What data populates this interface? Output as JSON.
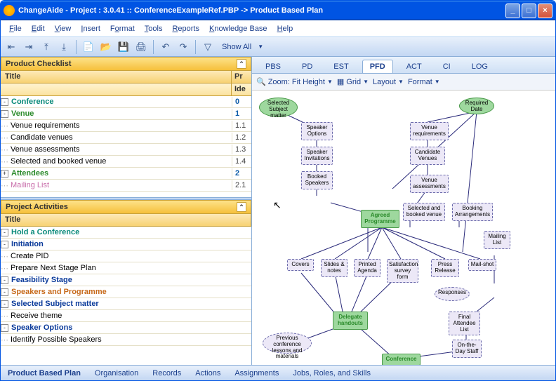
{
  "window": {
    "title": "ChangeAide - Project : 3.0.41  :: ConferenceExampleRef.PBP -> Product Based Plan"
  },
  "menu": {
    "file": "File",
    "edit": "Edit",
    "view": "View",
    "insert": "Insert",
    "format": "Format",
    "tools": "Tools",
    "reports": "Reports",
    "kb": "Knowledge Base",
    "help": "Help"
  },
  "toolbar": {
    "showall": "Show All"
  },
  "checklist": {
    "header": "Product Checklist",
    "col1": "Title",
    "col2": "Pr",
    "col2b": "Ide",
    "items": [
      {
        "label": "Conference",
        "num": "0",
        "lvl": 0,
        "cls": "teal",
        "tog": "-"
      },
      {
        "label": "Venue",
        "num": "1",
        "lvl": 1,
        "cls": "green",
        "tog": "-"
      },
      {
        "label": "Venue requirements",
        "num": "1.1",
        "lvl": 2
      },
      {
        "label": "Candidate venues",
        "num": "1.2",
        "lvl": 2
      },
      {
        "label": "Venue assessments",
        "num": "1.3",
        "lvl": 2
      },
      {
        "label": "Selected and booked venue",
        "num": "1.4",
        "lvl": 2
      },
      {
        "label": "Attendees",
        "num": "2",
        "lvl": 1,
        "cls": "green",
        "tog": "+"
      },
      {
        "label": "Mailing List",
        "num": "2.1",
        "lvl": 2,
        "cls": "pink"
      }
    ]
  },
  "activities": {
    "header": "Project Activities",
    "col1": "Title",
    "items": [
      {
        "label": "Hold a Conference",
        "lvl": 0,
        "cls": "teal",
        "tog": "-"
      },
      {
        "label": "Initiation",
        "lvl": 1,
        "cls": "blue",
        "tog": "-"
      },
      {
        "label": "Create PID",
        "lvl": 2
      },
      {
        "label": "Prepare Next Stage Plan",
        "lvl": 2
      },
      {
        "label": "Feasibility Stage",
        "lvl": 1,
        "cls": "blue",
        "tog": "-"
      },
      {
        "label": "Speakers and Programme",
        "lvl": 2,
        "cls": "orange",
        "tog": "-"
      },
      {
        "label": "Selected Subject matter",
        "lvl": 3,
        "cls": "blue",
        "tog": "-"
      },
      {
        "label": "Receive theme",
        "lvl": 4
      },
      {
        "label": "Speaker Options",
        "lvl": 3,
        "cls": "blue",
        "tog": "-"
      },
      {
        "label": "Identify Possible Speakers",
        "lvl": 4
      }
    ]
  },
  "tabs": {
    "pbs": "PBS",
    "pd": "PD",
    "est": "EST",
    "pfd": "PFD",
    "act": "ACT",
    "ci": "CI",
    "log": "LOG"
  },
  "dtool": {
    "zoom": "Zoom:",
    "fit": "Fit Height",
    "grid": "Grid",
    "layout": "Layout",
    "format": "Format"
  },
  "nodes": {
    "subjmatter": "Selected Subject matter",
    "reqdate": "Required Date",
    "spopt": "Speaker Options",
    "venreq": "Venue requirements",
    "spinv": "Speaker Invitations",
    "candven": "Candidate Venues",
    "bookedsp": "Booked Speakers",
    "venass": "Venue assessments",
    "agprog": "Agreed Programme",
    "selven": "Selected and booked venue",
    "bookarr": "Booking Arrangements",
    "maillist": "Mailing List",
    "covers": "Covers",
    "slides": "Slides & notes",
    "agenda": "Printed Agenda",
    "satform": "Satisfaction survey form",
    "press": "Press Release",
    "mailshot": "Mail-shot",
    "responses": "Responses",
    "delhand": "Delegate handouts",
    "finallist": "Final Attendee List",
    "prevconf": "Previous conference lessons and materials",
    "onday": "On-the-Day Staff",
    "conference": "Conference"
  },
  "btabs": {
    "pbp": "Product Based Plan",
    "org": "Organisation",
    "rec": "Records",
    "act": "Actions",
    "asn": "Assignments",
    "jrs": "Jobs, Roles, and Skills"
  }
}
